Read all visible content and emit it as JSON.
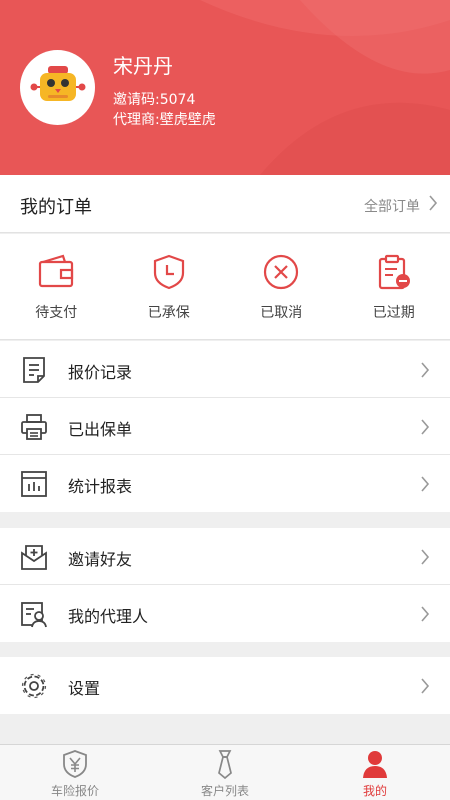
{
  "profile": {
    "name": "宋丹丹",
    "invite_code": "邀请码:5074",
    "agent": "代理商:壁虎壁虎",
    "avatar_icon": "robot-avatar-icon"
  },
  "orders": {
    "title": "我的订单",
    "all_label": "全部订单",
    "statuses": [
      {
        "label": "待支付",
        "icon": "wallet-icon"
      },
      {
        "label": "已承保",
        "icon": "shield-clock-icon"
      },
      {
        "label": "已取消",
        "icon": "cancel-circle-icon"
      },
      {
        "label": "已过期",
        "icon": "clipboard-expired-icon"
      }
    ]
  },
  "menu": {
    "group1": [
      {
        "label": "报价记录",
        "icon": "document-list-icon"
      },
      {
        "label": "已出保单",
        "icon": "printer-icon"
      },
      {
        "label": "统计报表",
        "icon": "bar-chart-icon"
      }
    ],
    "group2": [
      {
        "label": "邀请好友",
        "icon": "invite-mail-icon"
      },
      {
        "label": "我的代理人",
        "icon": "agent-card-icon"
      }
    ],
    "group3": [
      {
        "label": "设置",
        "icon": "gear-icon"
      }
    ]
  },
  "tabbar": {
    "tabs": [
      {
        "label": "车险报价",
        "icon": "shield-yen-icon",
        "active": false
      },
      {
        "label": "客户列表",
        "icon": "tie-icon",
        "active": false
      },
      {
        "label": "我的",
        "icon": "user-icon",
        "active": true
      }
    ]
  },
  "colors": {
    "brand": "#e85656",
    "accent_icon": "#e24848",
    "active_tab": "#e03a3a"
  }
}
